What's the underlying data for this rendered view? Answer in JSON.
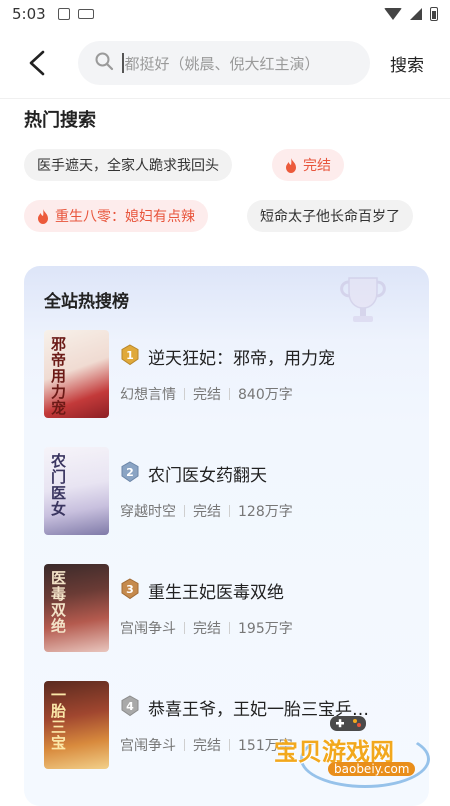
{
  "status_bar": {
    "time": "5:03"
  },
  "header": {
    "search_placeholder": "都挺好（姚晨、倪大红主演）",
    "search_button": "搜索"
  },
  "hot_search": {
    "title": "热门搜索",
    "chips": [
      {
        "label": "医手遮天，全家人跪求我回头",
        "hot": false
      },
      {
        "label": "完结",
        "hot": true
      },
      {
        "label": "重生八零：媳妇有点辣",
        "hot": true
      },
      {
        "label": "短命太子他长命百岁了",
        "hot": false
      }
    ]
  },
  "ranking": {
    "title": "全站热搜榜",
    "books": [
      {
        "rank": "1",
        "title": "逆天狂妃：邪帝，用力宠",
        "genre": "幻想言情",
        "status": "完结",
        "words": "840万字",
        "cover_text": "邪帝用力宠"
      },
      {
        "rank": "2",
        "title": "农门医女药翻天",
        "genre": "穿越时空",
        "status": "完结",
        "words": "128万字",
        "cover_text": "农门医女"
      },
      {
        "rank": "3",
        "title": "重生王妃医毒双绝",
        "genre": "宫闱争斗",
        "status": "完结",
        "words": "195万字",
        "cover_text": "医毒双绝"
      },
      {
        "rank": "4",
        "title": "恭喜王爷，王妃一胎三宝乒…",
        "genre": "宫闱争斗",
        "status": "完结",
        "words": "151万字",
        "cover_text": "一胎三宝"
      }
    ]
  },
  "watermark": {
    "name": "宝贝游戏网",
    "url": "baobeiy.com"
  },
  "colors": {
    "accent_hot": "#e8553c",
    "chip_bg": "#f2f2f2",
    "hot_chip_bg": "#fdecec",
    "gold": "#e0a93a",
    "silver": "#8aa4c4",
    "bronze": "#c58a4d"
  }
}
